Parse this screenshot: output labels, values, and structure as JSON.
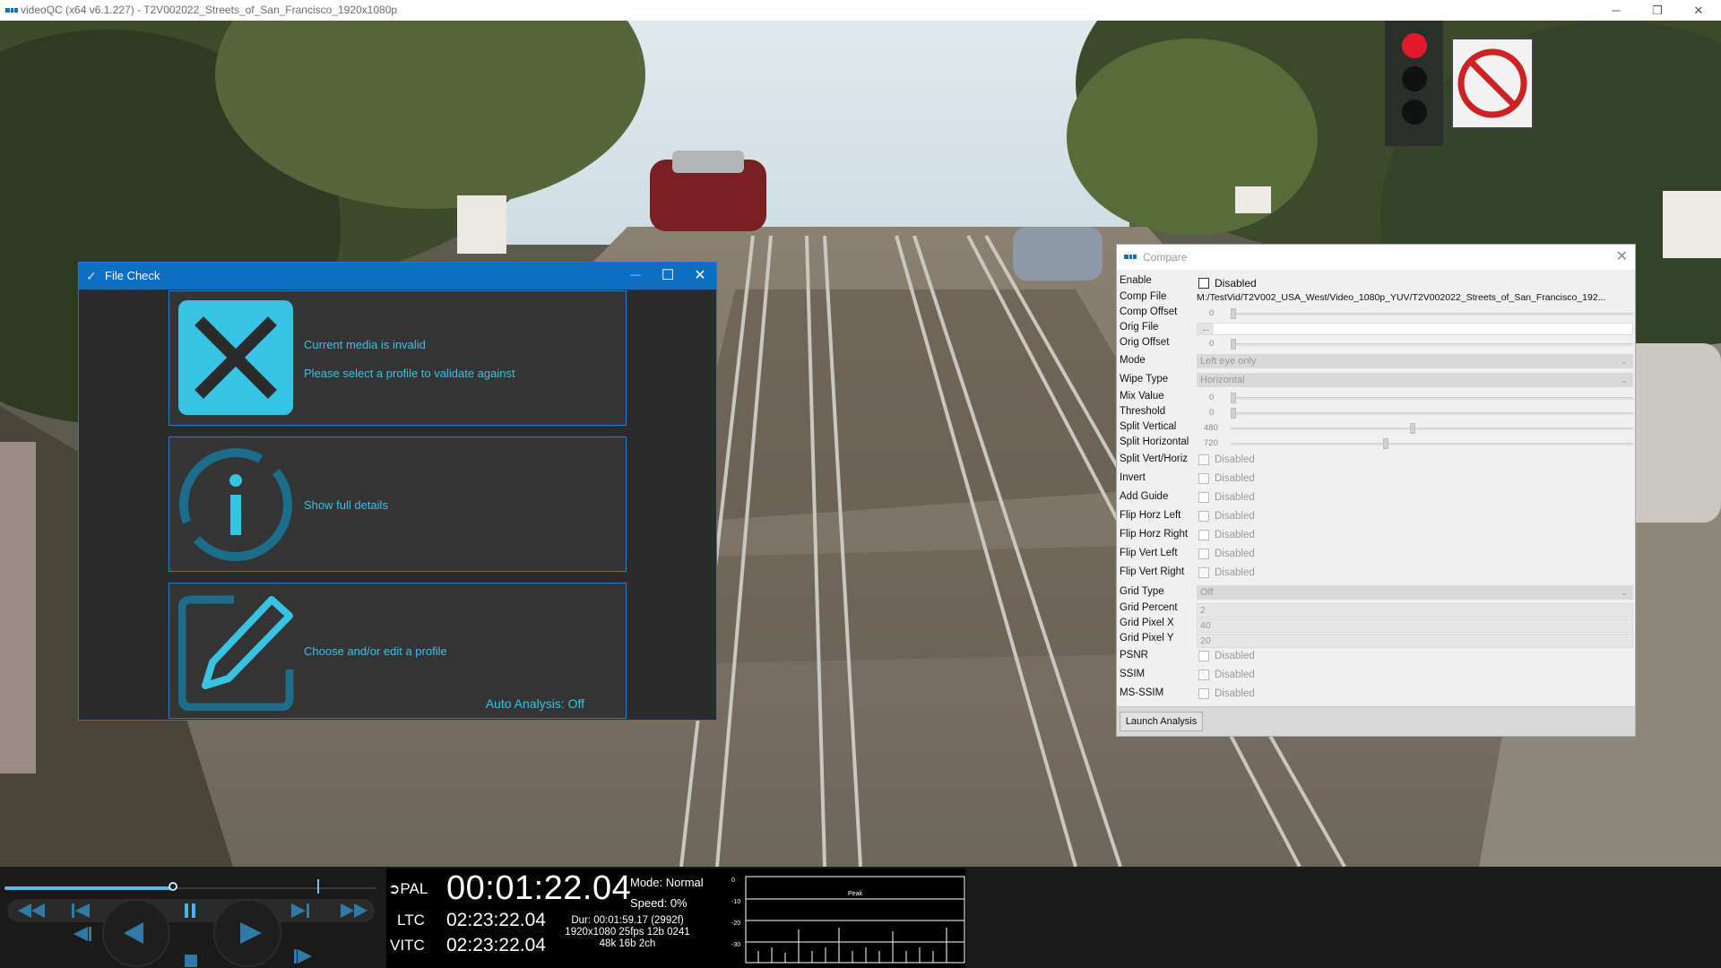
{
  "window": {
    "title": "videoQC (x64 v6.1.227) - T2V002022_Streets_of_San_Francisco_1920x1080p",
    "minimize": "─",
    "restore": "❐",
    "close": "✕"
  },
  "file_check": {
    "title": "File Check",
    "minimize": "─",
    "maximize": "☐",
    "close": "✕",
    "invalid_line1": "Current media is invalid",
    "invalid_line2": "Please select a profile to validate against",
    "details": "Show full details",
    "edit_profile": "Choose and/or edit a profile",
    "auto_analysis": "Auto Analysis: Off",
    "icons": [
      "close-x-icon",
      "info-icon",
      "edit-pencil-icon"
    ],
    "accent": "#37c3e3"
  },
  "compare": {
    "title": "Compare",
    "close": "✕",
    "rows": {
      "enable": {
        "label": "Enable",
        "value": "Disabled"
      },
      "comp_file": {
        "label": "Comp File",
        "value": "M:/TestVid/T2V002_USA_West/Video_1080p_YUV/T2V002022_Streets_of_San_Francisco_192..."
      },
      "comp_offset": {
        "label": "Comp Offset",
        "value": "0"
      },
      "orig_file": {
        "label": "Orig File",
        "value": "..."
      },
      "orig_offset": {
        "label": "Orig Offset",
        "value": "0"
      },
      "mode": {
        "label": "Mode",
        "value": "Left eye only"
      },
      "wipe_type": {
        "label": "Wipe Type",
        "value": "Horizontal"
      },
      "mix_value": {
        "label": "Mix Value",
        "value": "0"
      },
      "threshold": {
        "label": "Threshold",
        "value": "0"
      },
      "split_vertical": {
        "label": "Split Vertical",
        "value": "480"
      },
      "split_horizontal": {
        "label": "Split Horizontal",
        "value": "720"
      },
      "split_vert_horiz": {
        "label": "Split Vert/Horiz",
        "value": "Disabled"
      },
      "invert": {
        "label": "Invert",
        "value": "Disabled"
      },
      "add_guide": {
        "label": "Add Guide",
        "value": "Disabled"
      },
      "flip_horz_left": {
        "label": "Flip Horz Left",
        "value": "Disabled"
      },
      "flip_horz_right": {
        "label": "Flip Horz Right",
        "value": "Disabled"
      },
      "flip_vert_left": {
        "label": "Flip Vert Left",
        "value": "Disabled"
      },
      "flip_vert_right": {
        "label": "Flip Vert Right",
        "value": "Disabled"
      },
      "grid_type": {
        "label": "Grid Type",
        "value": "Off"
      },
      "grid_percent": {
        "label": "Grid Percent",
        "value": "2"
      },
      "grid_pixel_x": {
        "label": "Grid Pixel X",
        "value": "40"
      },
      "grid_pixel_y": {
        "label": "Grid Pixel Y",
        "value": "20"
      },
      "psnr": {
        "label": "PSNR",
        "value": "Disabled"
      },
      "ssim": {
        "label": "SSIM",
        "value": "Disabled"
      },
      "ms_ssim": {
        "label": "MS-SSIM",
        "value": "Disabled"
      }
    },
    "launch": "Launch Analysis"
  },
  "transport": {
    "playhead_fraction": 0.45,
    "icons": [
      "rewind-icon",
      "skip-back-icon",
      "pause-icon",
      "skip-forward-icon",
      "fast-forward-icon",
      "step-back-icon",
      "prev-icon",
      "stop-icon",
      "play-icon",
      "step-forward-icon"
    ],
    "accent": "#5fb5ea"
  },
  "info": {
    "standard": "PAL",
    "timecode": "00:01:22.04",
    "ltc_label": "LTC",
    "ltc": "02:23:22.04",
    "vitc_label": "VITC",
    "vitc": "02:23:22.04",
    "mode": "Mode: Normal",
    "speed": "Speed: 0%",
    "meta": "Dur: 00:01:59.17 (2992f)\n1920x1080 25fps 12b 0241\n48k 16b 2ch",
    "meter_title": "Peak",
    "meter_scale": [
      "0",
      "-10",
      "-20",
      "-30"
    ]
  }
}
